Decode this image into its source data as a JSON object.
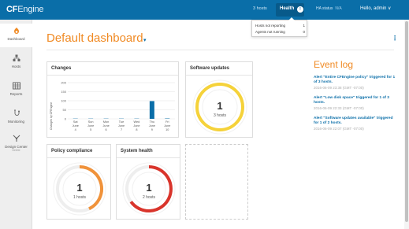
{
  "app": {
    "logo_cf": "CF",
    "logo_engine": "Engine"
  },
  "topbar": {
    "hosts": "3 hosts",
    "health_label": "Health",
    "health_badge": "!",
    "ha_label": "HA status",
    "ha_value": "N/A",
    "user": "Hello, admin ∨"
  },
  "health_dropdown": [
    {
      "label": "Hosts not reporting",
      "count": "1"
    },
    {
      "label": "Agents not running",
      "count": "0"
    }
  ],
  "sidebar": [
    {
      "label": "Dashboard",
      "icon": "dashboard-icon",
      "sub": ""
    },
    {
      "label": "Hosts",
      "icon": "hosts-icon",
      "sub": ""
    },
    {
      "label": "Reports",
      "icon": "reports-icon",
      "sub": ""
    },
    {
      "label": "Monitoring",
      "icon": "monitoring-icon",
      "sub": ""
    },
    {
      "label": "Design Center",
      "icon": "design-center-icon",
      "sub": "Delete"
    }
  ],
  "dashboard": {
    "title": "Default dashboard",
    "caret": "▾",
    "menu": "⋮"
  },
  "cards": {
    "changes": {
      "title": "Changes"
    },
    "software_updates": {
      "title": "Software updates",
      "value": "1",
      "unit": "3 hosts"
    },
    "policy_compliance": {
      "title": "Policy compliance",
      "value": "1",
      "unit": "1 hosts"
    },
    "system_health": {
      "title": "System health",
      "value": "1",
      "unit": "2 hosts"
    }
  },
  "chart_data": {
    "type": "bar",
    "title": "",
    "ylabel": "Changes by CFEngine",
    "ylim": [
      0,
      200
    ],
    "yticks": [
      "200",
      "150",
      "100",
      "50",
      "0"
    ],
    "categories": [
      [
        "Sat",
        "June",
        "4"
      ],
      [
        "Sun",
        "June",
        "5"
      ],
      [
        "Mon",
        "June",
        "6"
      ],
      [
        "Tue",
        "June",
        "7"
      ],
      [
        "Wed",
        "June",
        "8"
      ],
      [
        "Thu",
        "June",
        "9"
      ],
      [
        "Fri",
        "June",
        "10"
      ]
    ],
    "values": [
      0,
      0,
      0,
      0,
      0,
      98,
      2
    ],
    "grid": true,
    "bar_color": "#0a6ea8"
  },
  "event_log": {
    "title": "Event log",
    "items": [
      {
        "message": "Alert \"Entire CFEngine policy\" triggered for 1 of 3 hosts.",
        "time": "2016-06-09 23:38 (GMT -07:00)"
      },
      {
        "message": "Alert \"Low disk space\" triggered for 1 of 3 hosts.",
        "time": "2016-06-09 22:33 (GMT -07:00)"
      },
      {
        "message": "Alert \"Software updates available\" triggered for 1 of 2 hosts.",
        "time": "2016-06-09 22:07 (GMT -07:00)"
      }
    ]
  },
  "colors": {
    "brand": "#0a6ea8",
    "accent": "#f08a24",
    "gauge_yellow": "#f5d23a",
    "gauge_orange": "#f0923a",
    "gauge_red": "#d9342b"
  }
}
